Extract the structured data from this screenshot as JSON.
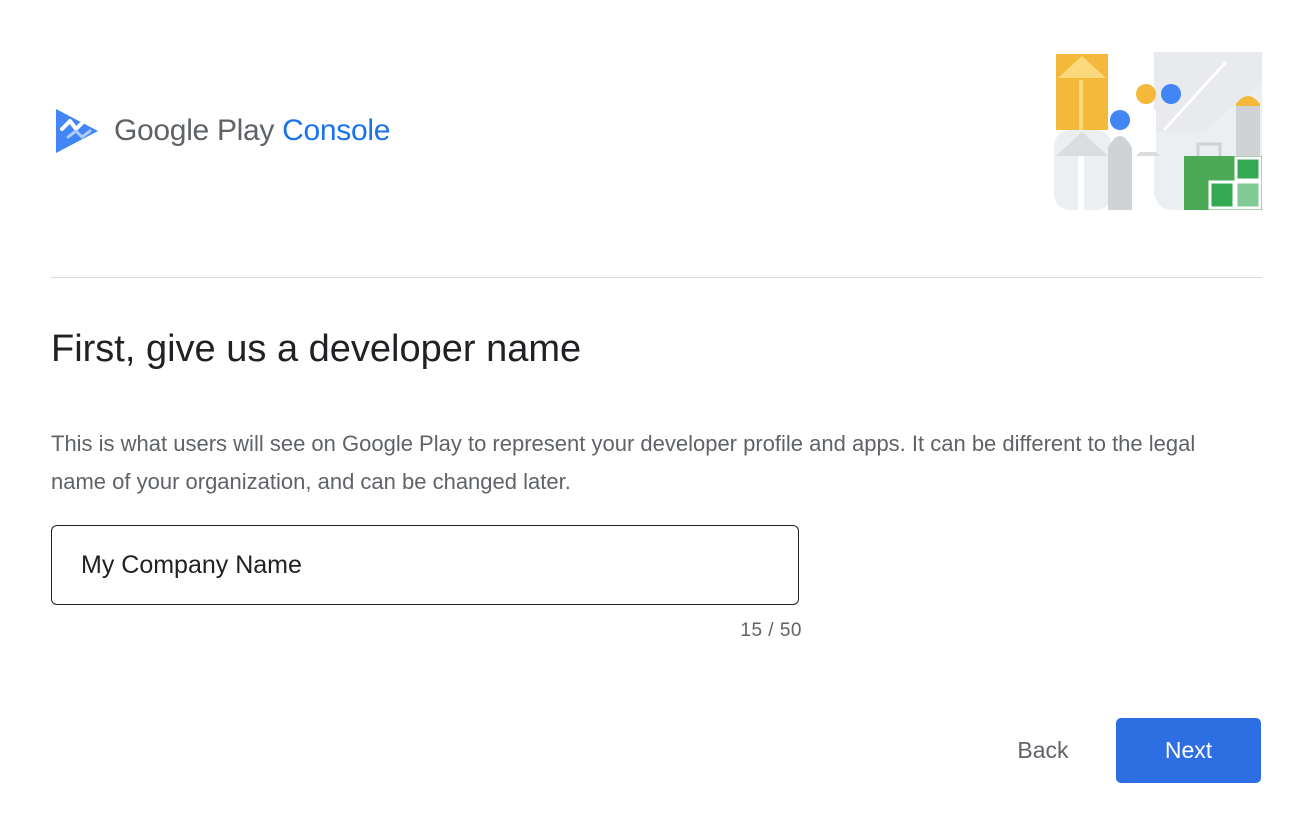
{
  "header": {
    "logo_icon": "play-console-icon",
    "logo_text_primary": "Google Play",
    "logo_text_accent": "Console",
    "brand_color": "#1a73e8",
    "illustration": "developer-illustration"
  },
  "main": {
    "title": "First, give us a developer name",
    "description": "This is what users will see on Google Play to represent your developer profile and apps. It can be different to the legal name of your organization, and can be changed later.",
    "developer_name": {
      "value": "My Company Name",
      "counter": "15 / 50"
    }
  },
  "footer": {
    "back_label": "Back",
    "next_label": "Next",
    "next_color": "#2d6ee3"
  }
}
